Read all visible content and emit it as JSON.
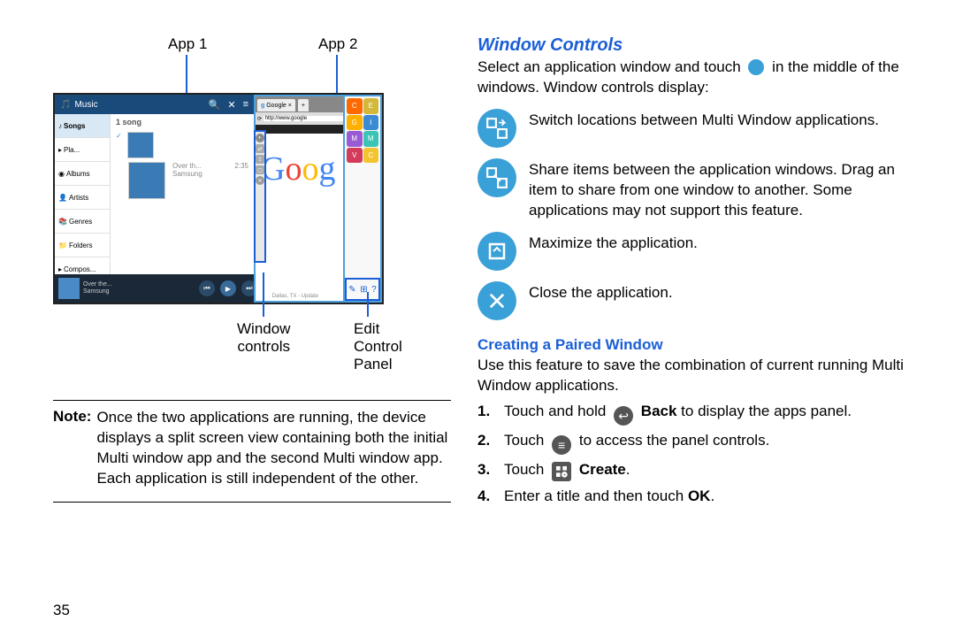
{
  "left": {
    "callouts": {
      "app1": "App 1",
      "app2": "App 2",
      "window_controls": "Window\ncontrols",
      "edit_panel": "Edit\nControl\nPanel"
    },
    "music": {
      "title": "Music",
      "nav": [
        "Songs",
        "Pla...",
        "Albums",
        "Artists",
        "Genres",
        "Folders",
        "Compos..."
      ],
      "song_count": "1 song",
      "track": {
        "title": "Over th...",
        "artist": "Samsung",
        "duration": "2:35"
      },
      "player": {
        "title": "Over the...",
        "artist": "Samsung"
      }
    },
    "browser": {
      "tab": "Google",
      "url": "http://www.google",
      "footer": "Dallas, TX - Update"
    },
    "tray": {
      "apps": [
        {
          "name": "ChatON",
          "color": "#ff6a00"
        },
        {
          "name": "Email",
          "color": "#d4b83a"
        },
        {
          "name": "Gallery",
          "color": "#ffb000"
        },
        {
          "name": "Internet",
          "color": "#3a8ad4"
        },
        {
          "name": "Music",
          "color": "#9a5ad4"
        },
        {
          "name": "My Files",
          "color": "#3ac4b4"
        },
        {
          "name": "Video",
          "color": "#d43a5a"
        },
        {
          "name": "Chrome",
          "color": "#f4c430"
        }
      ],
      "bottom": [
        "Edit",
        "Create",
        "Help"
      ]
    },
    "note_label": "Note:",
    "note": "Once the two applications are running, the device displays a split screen view containing both the initial Multi window app and the second Multi window app. Each application is still independent of the other."
  },
  "right": {
    "heading": "Window Controls",
    "intro1": "Select an application window and touch",
    "intro2": "in the middle of the windows. Window controls display:",
    "controls": [
      "Switch locations between Multi Window applications.",
      "Share items between the application windows. Drag an item to share from one window to another. Some applications may not support this feature.",
      "Maximize the application.",
      "Close the application."
    ],
    "subheading": "Creating a Paired Window",
    "sub_intro": "Use this feature to save the combination of current running Multi Window applications.",
    "steps": {
      "s1a": "Touch and hold",
      "s1b": "Back",
      "s1c": "to display the apps panel.",
      "s2a": "Touch",
      "s2b": "to access the panel controls.",
      "s3a": "Touch",
      "s3b": "Create",
      "s4": "Enter a title and then touch",
      "s4b": "OK"
    }
  },
  "page_number": "35"
}
